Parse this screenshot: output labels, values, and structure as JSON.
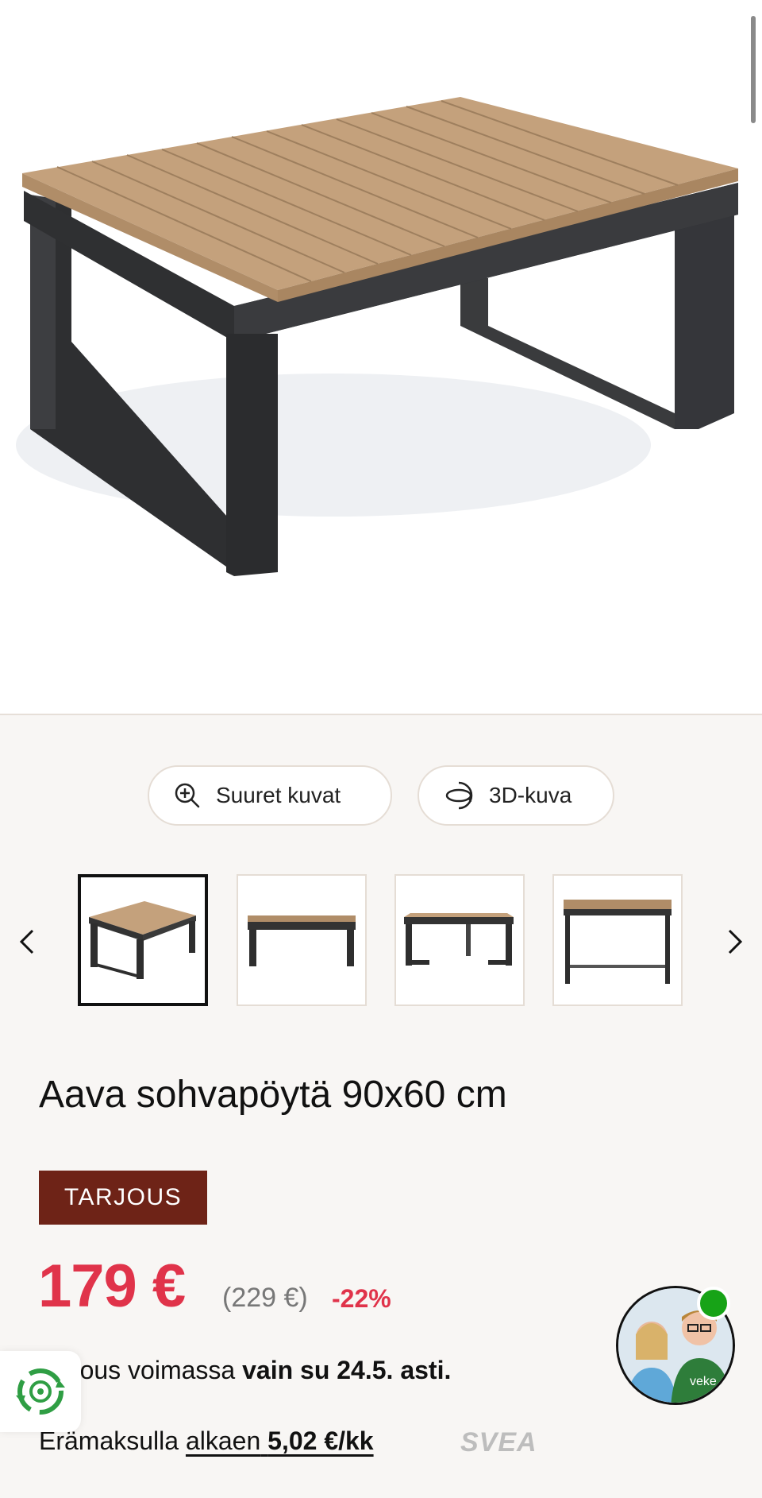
{
  "gallery": {
    "image_alt": "Aava sohvapöytä 90x60 cm",
    "zoom_button_label": "Suuret kuvat",
    "view3d_button_label": "3D-kuva",
    "thumbnails": [
      "front-angle",
      "side",
      "back-angle",
      "front"
    ],
    "active_thumbnail": 1
  },
  "product": {
    "title": "Aava sohvapöytä 90x60 cm",
    "badge": "TARJOUS",
    "price": "179 €",
    "original_price": "(229 €)",
    "discount": "-22%",
    "offer_prefix": "Tarjous voimassa ",
    "offer_bold": "vain su 24.5. asti.",
    "financing_prefix": "Erämaksulla ",
    "financing_link": "alkaen",
    "financing_amount": "5,02 €/kk",
    "financing_provider": "SVEA"
  },
  "widgets": {
    "chat_tshirt_text": "veke",
    "chat_online": true
  },
  "colors": {
    "price": "#e0334a",
    "badge": "#6e2317",
    "online": "#17a317"
  }
}
